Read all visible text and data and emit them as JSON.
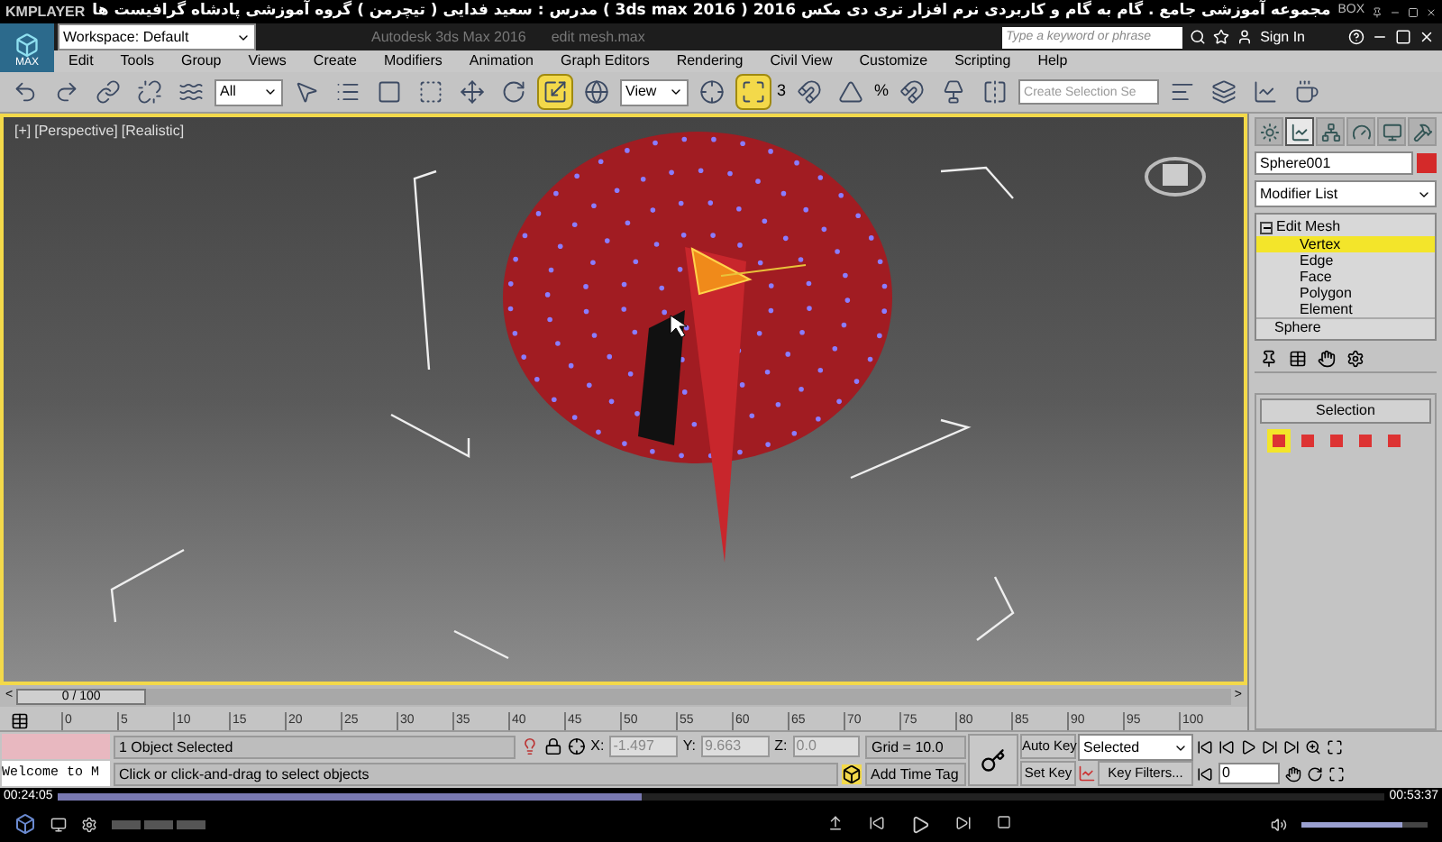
{
  "player": {
    "logo": "KMPLAYER",
    "title": "مجموعه آموزشی جامع . گام به گام و کاربردی نرم افزار تری دی مکس 2016 ( 3ds max 2016 )  مدرس : سعید فدایی ( تیچرمن ) گروه آموزشی پادشاه گرافیست ها",
    "box_label": "BOX"
  },
  "app": {
    "logo": "MAX",
    "workspace": "Workspace: Default",
    "title": "Autodesk 3ds Max 2016",
    "file": "edit mesh.max",
    "search": {
      "placeholder": "Type a keyword or phrase"
    },
    "sign_in": "Sign In"
  },
  "menu": [
    "Edit",
    "Tools",
    "Group",
    "Views",
    "Create",
    "Modifiers",
    "Animation",
    "Graph Editors",
    "Rendering",
    "Civil View",
    "Customize",
    "Scripting",
    "Help"
  ],
  "toolbar": {
    "selection_filter": "All",
    "reference_coord": "View",
    "snap_label": "3",
    "percent_label": "%",
    "named_selection": {
      "placeholder": "Create Selection Se"
    },
    "tools": [
      {
        "selected": false
      },
      {
        "selected": false
      },
      {
        "selected": false
      },
      {
        "selected": false
      },
      {
        "selected": false
      },
      {
        "selected": false
      },
      {
        "selected": false
      },
      {
        "selected": false
      },
      {
        "selected": false
      },
      {
        "selected": false
      },
      {
        "selected": false
      },
      {
        "selected": true
      },
      {
        "selected": false
      },
      {
        "selected": false
      },
      {
        "selected": true
      },
      {
        "selected": false
      },
      {
        "selected": false
      },
      {
        "selected": false
      },
      {
        "selected": false
      },
      {
        "selected": false
      },
      {
        "selected": false
      },
      {
        "selected": false
      },
      {
        "selected": false
      },
      {
        "selected": false
      }
    ]
  },
  "viewport": {
    "labels": [
      "[+]",
      "[Perspective]",
      "[Realistic]"
    ],
    "active": true
  },
  "command_panel": {
    "tabs": [
      {
        "selected": false
      },
      {
        "selected": true
      },
      {
        "selected": false
      },
      {
        "selected": false
      },
      {
        "selected": false
      },
      {
        "selected": false
      }
    ],
    "object_name": "Sphere001",
    "modifier_list": "Modifier List",
    "stack": [
      {
        "label": "Edit Mesh",
        "expanded": true,
        "selected": false,
        "children": [
          {
            "label": "Vertex",
            "selected": true
          },
          {
            "label": "Edge",
            "selected": false
          },
          {
            "label": "Face",
            "selected": false
          },
          {
            "label": "Polygon",
            "selected": false
          },
          {
            "label": "Element",
            "selected": false
          }
        ]
      },
      {
        "label": "Sphere",
        "selected": false
      }
    ],
    "selection_rollout": {
      "title": "Selection",
      "modes": [
        {
          "selected": true
        },
        {
          "selected": false
        },
        {
          "selected": false
        },
        {
          "selected": false
        },
        {
          "selected": false
        }
      ]
    }
  },
  "time_slider": {
    "prev": "<",
    "label": "0 / 100",
    "next": ">",
    "level": 0
  },
  "track_bar": {
    "ticks": [
      "0",
      "5",
      "10",
      "15",
      "20",
      "25",
      "30",
      "35",
      "40",
      "45",
      "50",
      "55",
      "60",
      "65",
      "70",
      "75",
      "80",
      "85",
      "90",
      "95",
      "100"
    ]
  },
  "status": {
    "script_listener": "Welcome to M",
    "selection": "1 Object Selected",
    "prompt": "Click or click-and-drag to select objects",
    "coords": [
      {
        "label": "X:",
        "value": "-1.497"
      },
      {
        "label": "Y:",
        "value": "9.663"
      },
      {
        "label": "Z:",
        "value": "0.0"
      }
    ],
    "grid": "Grid = 10.0",
    "time_tag": "Add Time Tag"
  },
  "animation": {
    "auto_key": "Auto Key",
    "key_mode": "Selected",
    "set_key": "Set Key",
    "key_filters": "Key Filters...",
    "frame": "0"
  },
  "playback": {
    "elapsed": "00:24:05",
    "total": "00:53:37",
    "level": 0.44,
    "volume": {
      "level": 0.8
    }
  }
}
